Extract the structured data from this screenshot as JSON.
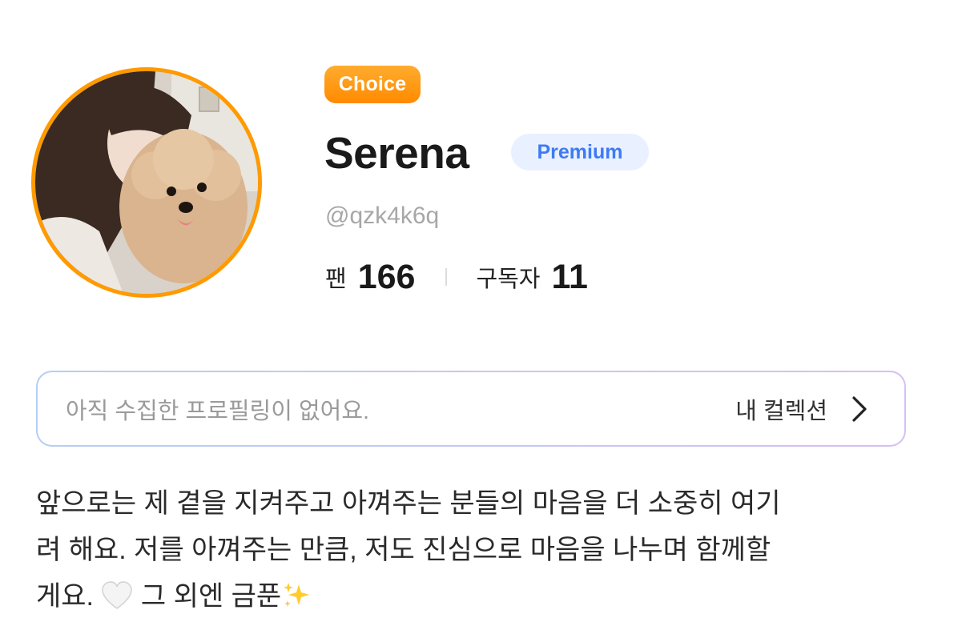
{
  "profile": {
    "choice_badge": "Choice",
    "name": "Serena",
    "premium_badge": "Premium",
    "handle": "@qzk4k6q",
    "stats": {
      "fans_label": "팬",
      "fans_value": "166",
      "subscribers_label": "구독자",
      "subscribers_value": "11"
    }
  },
  "collection": {
    "empty_text": "아직 수집한 프로필링이 없어요.",
    "link_label": "내 컬렉션"
  },
  "bio": {
    "line1": "앞으로는 제 곁을 지켜주고 아껴주는 분들의 마음을 더 소중히 여기",
    "line2": "려 해요. 저를 아껴주는 만큼, 저도 진심으로 마음을 나누며 함께할",
    "line3_prefix": "게요.",
    "line3_suffix": "그 외엔 금푼"
  },
  "colors": {
    "avatar_ring": "#ff9a00",
    "choice_badge": "#ff9500",
    "premium_text": "#3d7bf4",
    "premium_bg": "#e9f0ff"
  },
  "icons": [
    "avatar-photo",
    "chevron-right-icon",
    "white-heart-icon",
    "sparkles-icon"
  ]
}
